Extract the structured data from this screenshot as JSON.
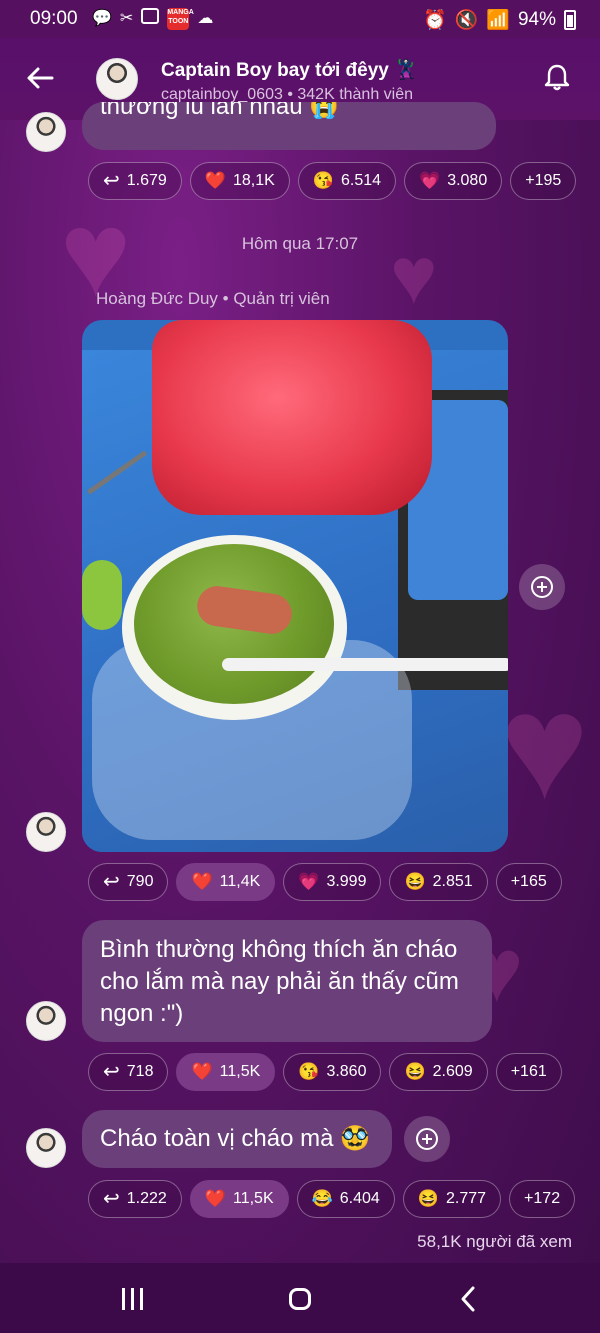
{
  "status_bar": {
    "time": "09:00",
    "battery": "94%",
    "manga_icon_text": "MANGA TOON"
  },
  "header": {
    "channel_name": "Captain Boy bay tới đêyy 🦹",
    "channel_sub": "captainboy_0603 • 342K thành viên"
  },
  "messages": {
    "first_partial": "thường lũ lắn nhau 😭",
    "first_reactions": [
      {
        "icon": "↩",
        "count": "1.679"
      },
      {
        "icon": "❤️",
        "count": "18,1K"
      },
      {
        "icon": "😘",
        "count": "6.514"
      },
      {
        "icon": "💗",
        "count": "3.080"
      },
      {
        "icon": "",
        "count": "+195"
      }
    ],
    "timestamp": "Hôm qua 17:07",
    "sender": "Hoàng Đức Duy • Quản trị viên",
    "photo_reactions": [
      {
        "icon": "↩",
        "count": "790"
      },
      {
        "icon": "❤️",
        "count": "11,4K"
      },
      {
        "icon": "💗",
        "count": "3.999"
      },
      {
        "icon": "😆",
        "count": "2.851"
      },
      {
        "icon": "",
        "count": "+165"
      }
    ],
    "text1": "Bình thường không thích ăn cháo cho lắm mà nay phải ăn thấy cũm ngon :\")",
    "text1_reactions": [
      {
        "icon": "↩",
        "count": "718"
      },
      {
        "icon": "❤️",
        "count": "11,5K"
      },
      {
        "icon": "😘",
        "count": "3.860"
      },
      {
        "icon": "😆",
        "count": "2.609"
      },
      {
        "icon": "",
        "count": "+161"
      }
    ],
    "text2": "Cháo toàn vị cháo mà 🥸",
    "text2_reactions": [
      {
        "icon": "↩",
        "count": "1.222"
      },
      {
        "icon": "❤️",
        "count": "11,5K"
      },
      {
        "icon": "😂",
        "count": "6.404"
      },
      {
        "icon": "😆",
        "count": "2.777"
      },
      {
        "icon": "",
        "count": "+172"
      }
    ],
    "viewers": "58,1K người đã xem"
  }
}
